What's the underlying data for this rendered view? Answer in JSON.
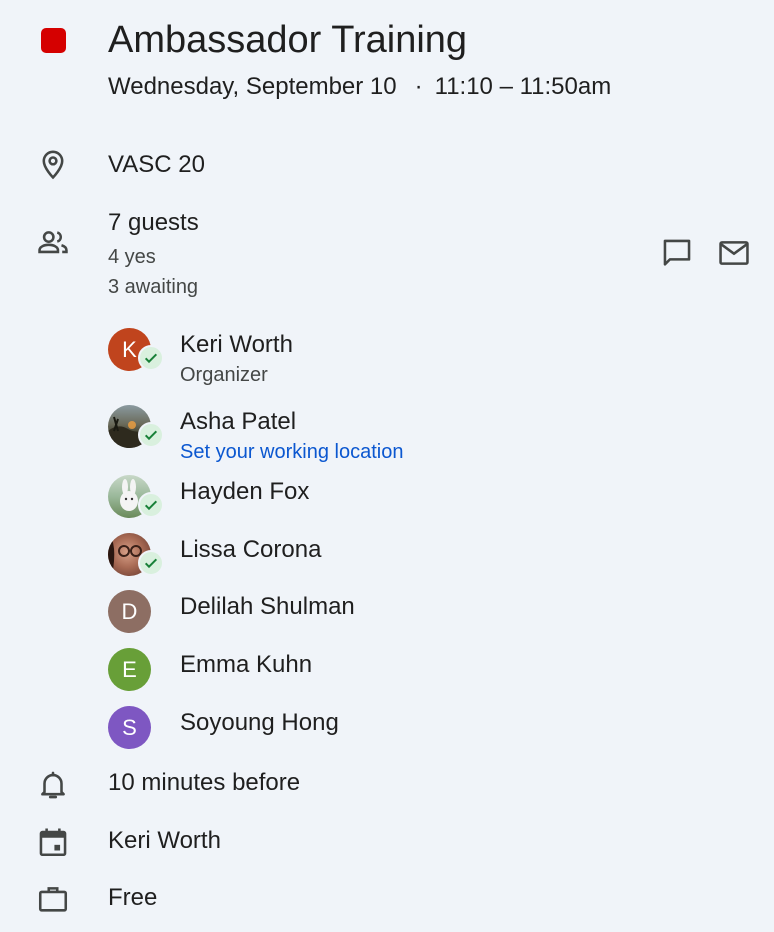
{
  "event": {
    "title": "Ambassador Training",
    "date": "Wednesday, September 10",
    "separator": "·",
    "time": "11:10 – 11:50am",
    "color": "#d50000"
  },
  "location": {
    "icon": "location-pin-icon",
    "text": "VASC 20"
  },
  "guests_summary": {
    "icon": "people-icon",
    "count_label": "7 guests",
    "yes_label": "4 yes",
    "awaiting_label": "3 awaiting",
    "actions": [
      {
        "icon": "chat-icon"
      },
      {
        "icon": "mail-icon"
      }
    ]
  },
  "guests": [
    {
      "name": "Keri Worth",
      "subtitle": "Organizer",
      "initial": "K",
      "avatar_color": "#c0441d",
      "accepted": true
    },
    {
      "name": "Asha Patel",
      "subtitle": "Set your working location",
      "initial": "",
      "avatar_color": "#5c5a4a",
      "accepted": true
    },
    {
      "name": "Hayden Fox",
      "subtitle": "",
      "initial": "",
      "avatar_color": "#8aa58a",
      "accepted": true
    },
    {
      "name": "Lissa Corona",
      "subtitle": "",
      "initial": "",
      "avatar_color": "#8a5a4a",
      "accepted": true
    },
    {
      "name": "Delilah Shulman",
      "subtitle": "",
      "initial": "D",
      "avatar_color": "#8d6e63",
      "accepted": false
    },
    {
      "name": "Emma Kuhn",
      "subtitle": "",
      "initial": "E",
      "avatar_color": "#689f38",
      "accepted": false
    },
    {
      "name": "Soyoung Hong",
      "subtitle": "",
      "initial": "S",
      "avatar_color": "#7e57c2",
      "accepted": false
    }
  ],
  "reminder": {
    "icon": "bell-icon",
    "text": "10 minutes before"
  },
  "calendar": {
    "icon": "calendar-icon",
    "text": "Keri Worth"
  },
  "availability": {
    "icon": "briefcase-icon",
    "text": "Free"
  }
}
